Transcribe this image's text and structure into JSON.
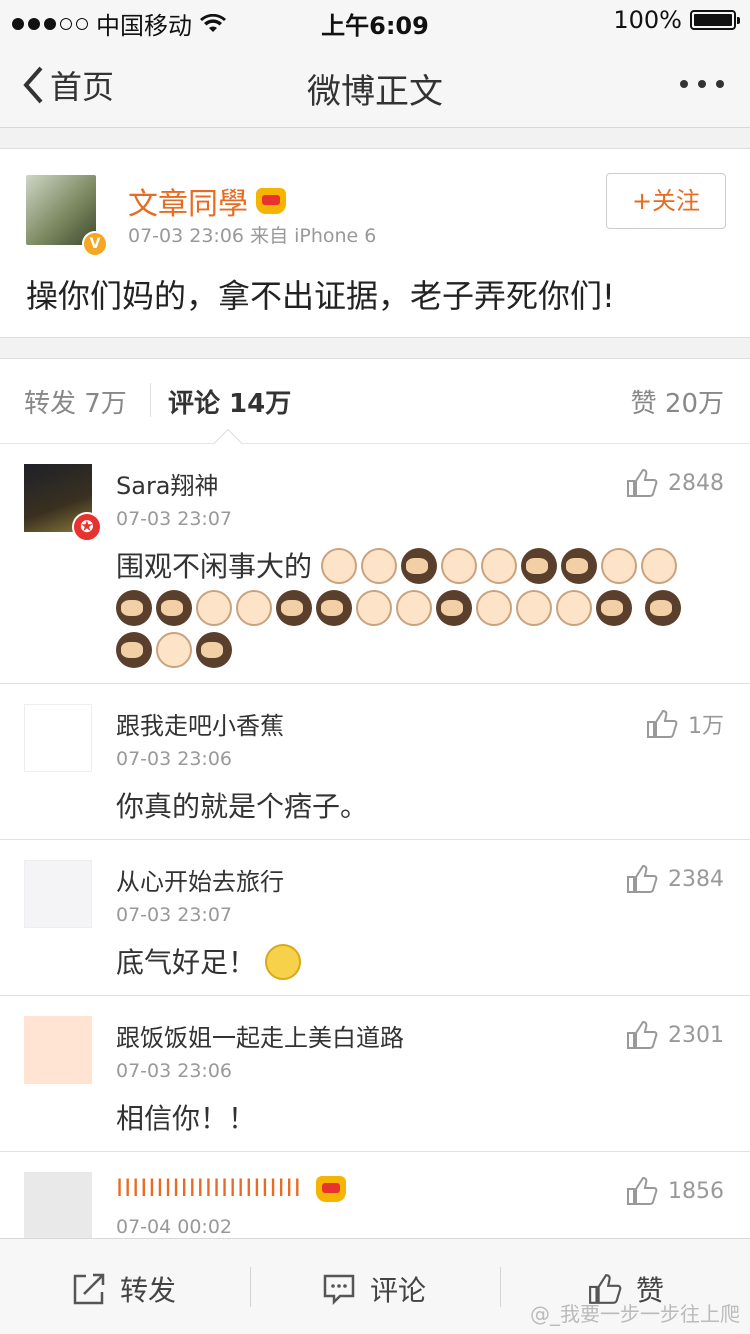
{
  "status": {
    "carrier": "中国移动",
    "time": "上午6:09",
    "battery": "100%"
  },
  "nav": {
    "back_label": "首页",
    "title": "微博正文"
  },
  "post": {
    "author": "文章同學",
    "time": "07-03 23:06",
    "source": "来自 iPhone 6",
    "follow_label": "+关注",
    "content": "操你们妈的，拿不出证据，老子弄死你们!"
  },
  "tabs": {
    "repost": "转发 7万",
    "comment": "评论 14万",
    "like": "赞 20万"
  },
  "comments": [
    {
      "name": "Sara翔神",
      "time": "07-03 23:07",
      "likes": "2848",
      "text": "围观不闲事大的"
    },
    {
      "name": "跟我走吧小香蕉",
      "time": "07-03 23:06",
      "likes": "1万",
      "text": "你真的就是个痞子。"
    },
    {
      "name": "从心开始去旅行",
      "time": "07-03 23:07",
      "likes": "2384",
      "text": "底气好足！"
    },
    {
      "name": "跟饭饭姐一起走上美白道路",
      "time": "07-03 23:06",
      "likes": "2301",
      "text": "相信你！！"
    },
    {
      "name": "IIIIIIIIIIIIIIIIIIIIIII",
      "time": "07-04 00:02",
      "likes": "1856",
      "text": ""
    }
  ],
  "toolbar": {
    "repost": "转发",
    "comment": "评论",
    "like": "赞"
  },
  "watermark": "@_我要一步一步往上爬",
  "icons": [
    "wifi-icon",
    "back-chevron-icon",
    "more-icon",
    "verified-v-icon",
    "crown-icon",
    "thumbs-up-icon",
    "repost-icon",
    "comment-icon",
    "star-badge-icon"
  ]
}
